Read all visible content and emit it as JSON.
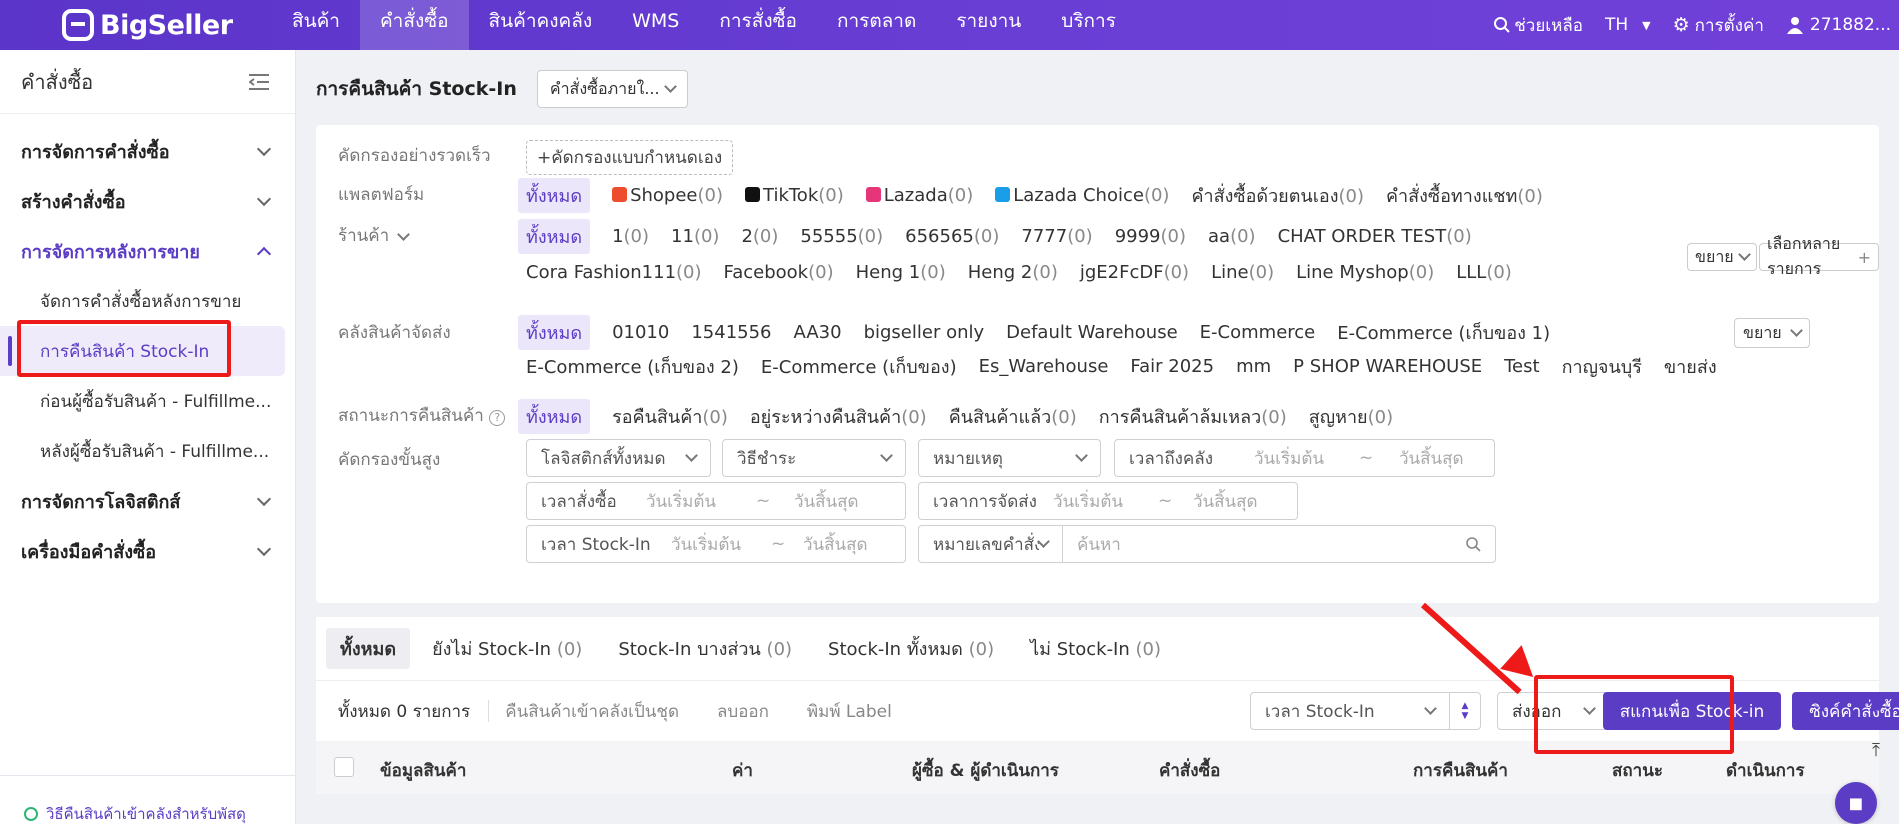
{
  "topnav": {
    "logo": "BigSeller",
    "items": [
      "สินค้า",
      "คำสั่งซื้อ",
      "สินค้าคงคลัง",
      "WMS",
      "การสั่งซื้อ",
      "การตลาด",
      "รายงาน",
      "บริการ"
    ],
    "help": "ช่วยเหลือ",
    "lang": "TH",
    "settings": "การตั้งค่า",
    "user": "271882..."
  },
  "sidebar": {
    "title": "คำสั่งซื้อ",
    "groups": [
      "การจัดการคำสั่งซื้อ",
      "สร้างคำสั่งซื้อ",
      "การจัดการหลังการขาย",
      "การจัดการโลจิสติกส์",
      "เครื่องมือคำสั่งซื้อ"
    ],
    "subitems": [
      "จัดการคำสั่งซื้อหลังการขาย",
      "การคืนสินค้า Stock-In",
      "ก่อนผู้ซื้อรับสินค้า - Fulfillme...",
      "หลังผู้ซื้อรับสินค้า - Fulfillme..."
    ],
    "footer": "วิธีคืนสินค้าเข้าคลังสำหรับพัสดุ"
  },
  "page": {
    "title": "การคืนสินค้า Stock-In",
    "order_select": "คำสั่งซื้อภายใ..."
  },
  "filters": {
    "quick_label": "คัดกรองอย่างรวดเร็ว",
    "custom_btn": "+คัดกรองแบบกำหนดเอง",
    "platform_label": "แพลตฟอร์ม",
    "platforms": [
      {
        "name": "ทั้งหมด",
        "count": ""
      },
      {
        "name": "Shopee",
        "count": "(0)"
      },
      {
        "name": "TikTok",
        "count": "(0)"
      },
      {
        "name": "Lazada",
        "count": "(0)"
      },
      {
        "name": "Lazada Choice",
        "count": "(0)"
      },
      {
        "name": "คำสั่งซื้อด้วยตนเอง",
        "count": "(0)"
      },
      {
        "name": "คำสั่งซื้อทางแชท",
        "count": "(0)"
      }
    ],
    "store_label": "ร้านค้า",
    "stores_row1": [
      {
        "name": "ทั้งหมด",
        "count": ""
      },
      {
        "name": "1",
        "count": "(0)"
      },
      {
        "name": "11",
        "count": "(0)"
      },
      {
        "name": "2",
        "count": "(0)"
      },
      {
        "name": "55555",
        "count": "(0)"
      },
      {
        "name": "656565",
        "count": "(0)"
      },
      {
        "name": "7777",
        "count": "(0)"
      },
      {
        "name": "9999",
        "count": "(0)"
      },
      {
        "name": "aa",
        "count": "(0)"
      },
      {
        "name": "CHAT ORDER TEST",
        "count": "(0)"
      }
    ],
    "stores_row2": [
      {
        "name": "Cora Fashion111",
        "count": "(0)"
      },
      {
        "name": "Facebook",
        "count": "(0)"
      },
      {
        "name": "Heng 1",
        "count": "(0)"
      },
      {
        "name": "Heng 2",
        "count": "(0)"
      },
      {
        "name": "jgE2FcDF",
        "count": "(0)"
      },
      {
        "name": "Line",
        "count": "(0)"
      },
      {
        "name": "Line Myshop",
        "count": "(0)"
      },
      {
        "name": "LLL",
        "count": "(0)"
      }
    ],
    "expand": "ขยาย",
    "multi_select": "เลือกหลายรายการ",
    "warehouse_label": "คลังสินค้าจัดส่ง",
    "warehouses_row1": [
      "ทั้งหมด",
      "01010",
      "1541556",
      "AA30",
      "bigseller only",
      "Default Warehouse",
      "E-Commerce",
      "E-Commerce (เก็บของ 1)"
    ],
    "warehouses_row2": [
      "E-Commerce (เก็บของ 2)",
      "E-Commerce (เก็บของ)",
      "Es_Warehouse",
      "Fair 2025",
      "mm",
      "P SHOP WAREHOUSE",
      "Test",
      "กาญจนบุรี",
      "ขายส่ง"
    ],
    "status_label": "สถานะการคืนสินค้า",
    "statuses": [
      {
        "name": "ทั้งหมด",
        "count": ""
      },
      {
        "name": "รอคืนสินค้า",
        "count": "(0)"
      },
      {
        "name": "อยู่ระหว่างคืนสินค้า",
        "count": "(0)"
      },
      {
        "name": "คืนสินค้าแล้ว",
        "count": "(0)"
      },
      {
        "name": "การคืนสินค้าล้มเหลว",
        "count": "(0)"
      },
      {
        "name": "สูญหาย",
        "count": "(0)"
      }
    ],
    "advanced_label": "คัดกรองขั้นสูง",
    "logistics": "โลจิสติกส์ทั้งหมด",
    "payment": "วิธีชำระ",
    "reason": "หมายเหตุ",
    "arrival_time": "เวลาถึงคลัง",
    "order_time": "เวลาสั่งซื้อ",
    "ship_time": "เวลาการจัดส่ง",
    "stockin_time": "เวลา Stock-In",
    "start_date": "วันเริ่มต้น",
    "end_date": "วันสิ้นสุด",
    "tilde": "~",
    "order_no": "หมายเลขคำสั่ง...",
    "search_placeholder": "ค้นหา"
  },
  "tabs": [
    {
      "label": "ทั้งหมด",
      "count": ""
    },
    {
      "label": "ยังไม่ Stock-In",
      "count": "(0)"
    },
    {
      "label": "Stock-In บางส่วน",
      "count": "(0)"
    },
    {
      "label": "Stock-In ทั้งหมด",
      "count": "(0)"
    },
    {
      "label": "ไม่ Stock-In",
      "count": "(0)"
    }
  ],
  "toolbar": {
    "total": "ทั้งหมด 0 รายการ",
    "bulk_return": "คืนสินค้าเข้าคลังเป็นชุด",
    "delete": "ลบออก",
    "print": "พิมพ์ Label",
    "sort": "เวลา Stock-In",
    "export": "ส่งออก",
    "scan": "สแกนเพื่อ Stock-in",
    "sync": "ซิงค์คำสั่งซื้อ"
  },
  "table": {
    "headers": [
      "ข้อมูลสินค้า",
      "ค่า",
      "ผู้ซื้อ & ผู้ดำเนินการ",
      "คำสั่งซื้อ",
      "การคืนสินค้า",
      "สถานะ",
      "ดำเนินการ"
    ]
  },
  "colors": {
    "primary": "#5b3cc4",
    "highlight": "#ee1a1a"
  }
}
